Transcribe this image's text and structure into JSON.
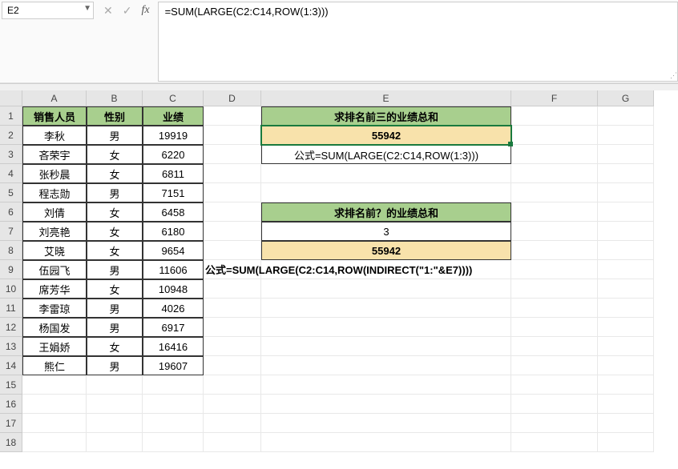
{
  "formula_bar": {
    "name_box": "E2",
    "formula": "=SUM(LARGE(C2:C14,ROW(1:3)))"
  },
  "columns": [
    "A",
    "B",
    "C",
    "D",
    "E",
    "F",
    "G"
  ],
  "rows": [
    "1",
    "2",
    "3",
    "4",
    "5",
    "6",
    "7",
    "8",
    "9",
    "10",
    "11",
    "12",
    "13",
    "14",
    "15",
    "16",
    "17",
    "18"
  ],
  "headers": {
    "A": "销售人员",
    "B": "性别",
    "C": "业绩"
  },
  "data_rows": [
    {
      "name": "李秋",
      "gender": "男",
      "perf": "19919"
    },
    {
      "name": "吝荣宇",
      "gender": "女",
      "perf": "6220"
    },
    {
      "name": "张秒晨",
      "gender": "女",
      "perf": "6811"
    },
    {
      "name": "程志勋",
      "gender": "男",
      "perf": "7151"
    },
    {
      "name": "刘倩",
      "gender": "女",
      "perf": "6458"
    },
    {
      "name": "刘亮艳",
      "gender": "女",
      "perf": "6180"
    },
    {
      "name": "艾晓",
      "gender": "女",
      "perf": "9654"
    },
    {
      "name": "伍园飞",
      "gender": "男",
      "perf": "11606"
    },
    {
      "name": "席芳华",
      "gender": "女",
      "perf": "10948"
    },
    {
      "name": "李雷琼",
      "gender": "男",
      "perf": "4026"
    },
    {
      "name": "杨国发",
      "gender": "男",
      "perf": "6917"
    },
    {
      "name": "王娟娇",
      "gender": "女",
      "perf": "16416"
    },
    {
      "name": "熊仁",
      "gender": "男",
      "perf": "19607"
    }
  ],
  "side": {
    "title1": "求排名前三的业绩总和",
    "result1": "55942",
    "formula1": "公式=SUM(LARGE(C2:C14,ROW(1:3)))",
    "title2": "求排名前？的业绩总和",
    "input2": "3",
    "result2": "55942",
    "formula2": "公式=SUM(LARGE(C2:C14,ROW(INDIRECT(\"1:\"&E7))))"
  },
  "icons": {
    "cancel": "✕",
    "confirm": "✓",
    "fx": "fx",
    "dropdown": "▼"
  }
}
